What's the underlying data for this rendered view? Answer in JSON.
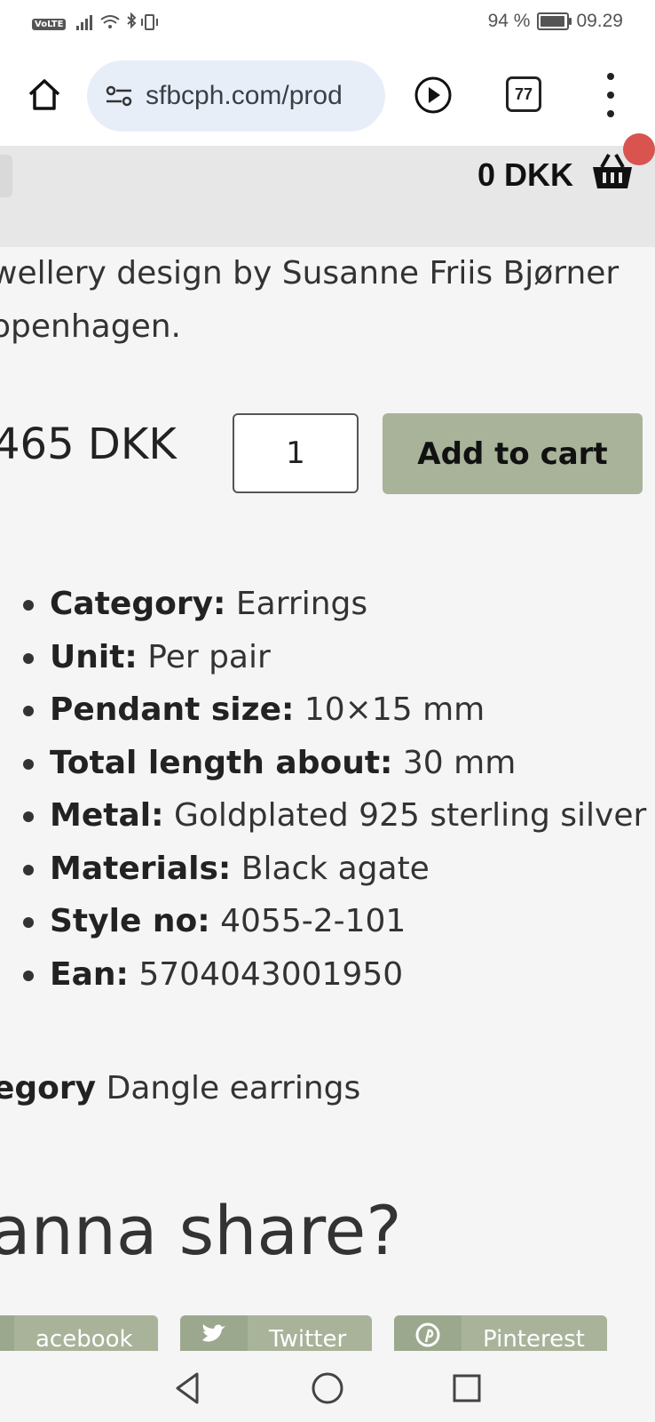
{
  "status_bar": {
    "battery_text": "94 %",
    "battery_level": 0.94,
    "time": "09.29",
    "volte_label": "VoLTE"
  },
  "browser": {
    "url": "sfbcph.com/prod",
    "tab_count": "77"
  },
  "header": {
    "cart_total": "0 DKK"
  },
  "product": {
    "desc_line1": "wellery design by Susanne Friis Bjørner",
    "desc_line2": "openhagen.",
    "price": "465 DKK",
    "quantity": "1",
    "add_to_cart_label": "Add to cart"
  },
  "specs": [
    {
      "label": "Category:",
      "value": "Earrings"
    },
    {
      "label": "Unit:",
      "value": "Per pair"
    },
    {
      "label": "Pendant size:",
      "value": "10×15 mm"
    },
    {
      "label": "Total length about:",
      "value": "30 mm"
    },
    {
      "label": "Metal:",
      "value": "Goldplated 925 sterling silver"
    },
    {
      "label": "Materials:",
      "value": "Black agate"
    },
    {
      "label": "Style no:",
      "value": "4055-2-101"
    },
    {
      "label": "Ean:",
      "value": "5704043001950"
    }
  ],
  "category_line": {
    "label": "egory",
    "value": "Dangle earrings"
  },
  "share": {
    "title": "anna share?",
    "buttons": [
      {
        "label": "acebook",
        "icon": "facebook-icon"
      },
      {
        "label": "Twitter",
        "icon": "twitter-icon"
      },
      {
        "label": "Pinterest",
        "icon": "pinterest-icon"
      }
    ]
  },
  "colors": {
    "accent": "#a8b39a",
    "accent_dark": "#9ca88e",
    "header_bg": "#e7e7e7",
    "page_bg": "#f5f5f5",
    "url_pill": "#e8eef8",
    "badge": "#d9534f"
  }
}
